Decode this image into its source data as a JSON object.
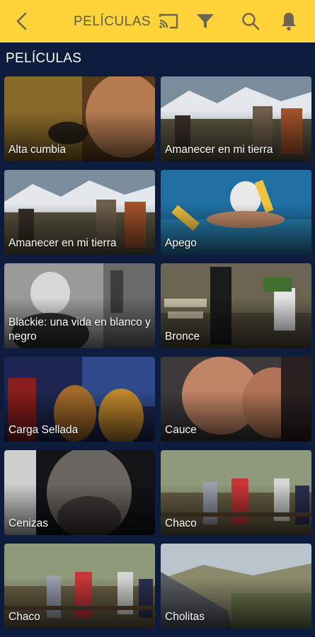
{
  "header": {
    "title": "PELÍCULAS",
    "icons": [
      "back-arrow-icon",
      "cast-icon",
      "filter-icon",
      "search-icon",
      "bell-icon"
    ]
  },
  "section": {
    "title": "PELÍCULAS"
  },
  "movies": [
    {
      "title": "Alta cumbia",
      "scene": "closeup"
    },
    {
      "title": "Amanecer en mi tierra",
      "scene": "mountains"
    },
    {
      "title": "Amanecer en mi tierra",
      "scene": "mountains"
    },
    {
      "title": "Apego",
      "scene": "pool"
    },
    {
      "title": "Blackie: una vida en blanco y negro",
      "scene": "bw"
    },
    {
      "title": "Bronce",
      "scene": "cemetery"
    },
    {
      "title": "Carga Sellada",
      "scene": "night"
    },
    {
      "title": "Cauce",
      "scene": "kiss"
    },
    {
      "title": "Cenizas",
      "scene": "dark"
    },
    {
      "title": "Chaco",
      "scene": "field"
    },
    {
      "title": "Chaco",
      "scene": "field"
    },
    {
      "title": "Cholitas",
      "scene": "valley"
    }
  ]
}
